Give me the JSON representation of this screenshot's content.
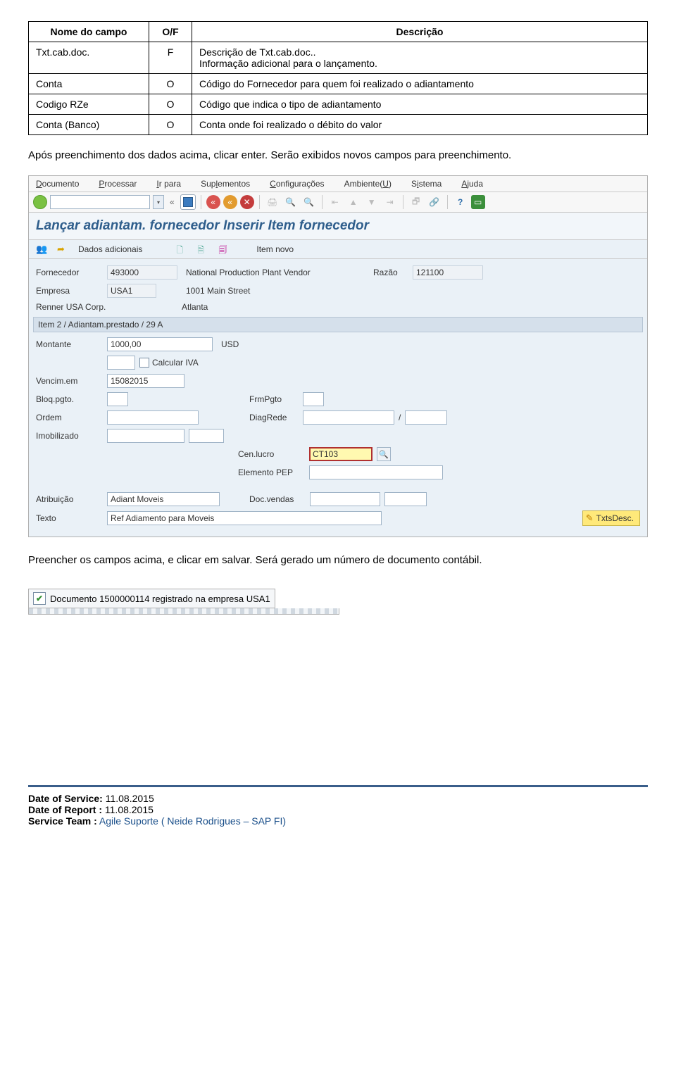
{
  "table": {
    "headers": [
      "Nome do campo",
      "O/F",
      "Descrição"
    ],
    "rows": [
      {
        "name": "Txt.cab.doc.",
        "of": "F",
        "desc_line1": "Descrição de Txt.cab.doc..",
        "desc_line2": "Informação adicional para o lançamento."
      },
      {
        "name": "Conta",
        "of": "O",
        "desc_line1": "Código do Fornecedor para quem foi realizado o adiantamento",
        "desc_line2": ""
      },
      {
        "name": "Codigo RZe",
        "of": "O",
        "desc_line1": "Código que indica o tipo de adiantamento",
        "desc_line2": ""
      },
      {
        "name": "Conta (Banco)",
        "of": "O",
        "desc_line1": "Conta onde foi realizado o débito do valor",
        "desc_line2": ""
      }
    ]
  },
  "para1": "Após preenchimento dos dados acima, clicar enter. Serão exibidos novos campos para preenchimento.",
  "para2": "Preencher os campos acima, e clicar em salvar. Será gerado um número de documento contábil.",
  "sap": {
    "menus": {
      "documento": "Documento",
      "processar": "Processar",
      "ir_para": "Ir para",
      "suplementos": "Suplementos",
      "configuracoes": "Configurações",
      "ambiente": "Ambiente(U)",
      "sistema": "Sistema",
      "ajuda": "Ajuda"
    },
    "title": "Lançar adiantam. fornecedor Inserir Item fornecedor",
    "subtoolbar": {
      "dados_adicionais": "Dados adicionais",
      "item_novo": "Item novo"
    },
    "fornecedor": {
      "label": "Fornecedor",
      "code": "493000",
      "name": "National Production Plant Vendor",
      "razao_label": "Razão",
      "razao": "121100"
    },
    "empresa": {
      "label": "Empresa",
      "code": "USA1",
      "addr": "1001 Main Street"
    },
    "company": {
      "name": "Renner USA Corp.",
      "city": "Atlanta"
    },
    "section": "Item 2 / Adiantam.prestado / 29 A",
    "montante": {
      "label": "Montante",
      "value": "1000,00",
      "currency": "USD"
    },
    "calcular_iva": "Calcular IVA",
    "vencim": {
      "label": "Vencim.em",
      "value": "15082015"
    },
    "bloq": {
      "label": "Bloq.pgto.",
      "frm_label": "FrmPgto"
    },
    "ordem": {
      "label": "Ordem",
      "diag_label": "DiagRede",
      "slash": "/"
    },
    "imob": {
      "label": "Imobilizado"
    },
    "cenlucro": {
      "label": "Cen.lucro",
      "value": "CT103"
    },
    "pep": {
      "label": "Elemento PEP"
    },
    "atrib": {
      "label": "Atribuição",
      "value": "Adiant Moveis",
      "doc_label": "Doc.vendas"
    },
    "texto": {
      "label": "Texto",
      "value": "Ref Adiamento para Moveis",
      "txts": "TxtsDesc."
    }
  },
  "status": "Documento 1500000114 registrado na empresa USA1",
  "footer": {
    "service_label": "Date of Service:",
    "service_value": " 11.08.2015",
    "report_label": "Date of Report :",
    "report_value": " 11.08.2015",
    "team_label": "Service Team :",
    "team_value": "   Agile Suporte ( Neide Rodrigues – SAP FI)"
  }
}
